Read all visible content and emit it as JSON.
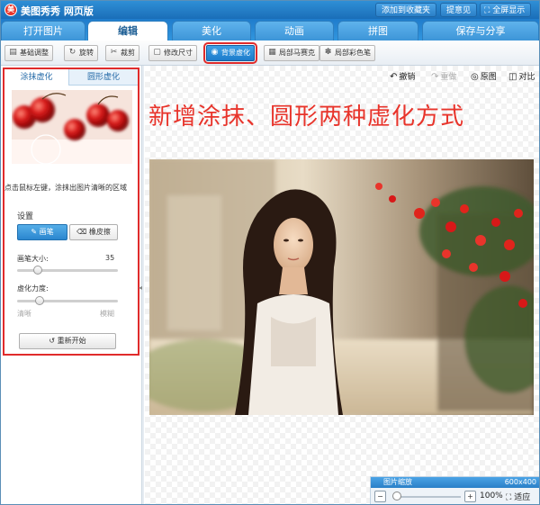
{
  "app": {
    "title": "美图秀秀 网页版",
    "logo_char": "美"
  },
  "top_links": {
    "bookmark": "添加到收藏夹",
    "feedback": "提意见",
    "fullscreen": "全屏显示"
  },
  "main_tabs": [
    {
      "label": "打开图片",
      "active": false
    },
    {
      "label": "编辑",
      "active": true
    },
    {
      "label": "美化",
      "active": false
    },
    {
      "label": "动画",
      "active": false
    },
    {
      "label": "拼图",
      "active": false
    },
    {
      "label": "保存与分享",
      "active": false
    }
  ],
  "toolbar": {
    "buttons": [
      {
        "label": "基础调整",
        "icon": "adjust-icon",
        "active": false
      },
      {
        "label": "旋转",
        "icon": "rotate-icon",
        "active": false
      },
      {
        "label": "裁剪",
        "icon": "crop-icon",
        "active": false
      },
      {
        "label": "修改尺寸",
        "icon": "resize-icon",
        "active": false
      },
      {
        "label": "背景虚化",
        "icon": "blur-icon",
        "active": true
      },
      {
        "label": "局部马赛克",
        "icon": "mosaic-icon",
        "active": false
      },
      {
        "label": "局部彩色笔",
        "icon": "color-pen-icon",
        "active": false
      }
    ]
  },
  "left_panel": {
    "subtabs": [
      {
        "label": "涂抹虚化",
        "active": true
      },
      {
        "label": "圆形虚化",
        "active": false
      }
    ],
    "hint": "点击鼠标左键，涂抹出图片清晰的区域",
    "settings_label": "设置",
    "modes": [
      {
        "label": "画笔",
        "icon": "brush-icon",
        "active": true
      },
      {
        "label": "橡皮擦",
        "icon": "eraser-icon",
        "active": false
      }
    ],
    "brush_size": {
      "label": "画笔大小:",
      "value": "35",
      "fraction": 0.18
    },
    "blur_strength": {
      "label": "虚化力度:",
      "min_label": "清晰",
      "max_label": "模糊",
      "fraction": 0.2
    },
    "restart_label": "重新开始"
  },
  "canvas_actions": {
    "undo": "撤销",
    "redo": "重做",
    "original": "原图",
    "compare": "对比"
  },
  "headline": "新增涂抹、圆形两种虚化方式",
  "zoom": {
    "title": "图片缩放",
    "size": "600x400",
    "percent": "100%",
    "fit": "适应"
  },
  "colors": {
    "accent_blue": "#2a86cf",
    "highlight_red": "#e02b2b",
    "headline_red": "#e8342b"
  }
}
